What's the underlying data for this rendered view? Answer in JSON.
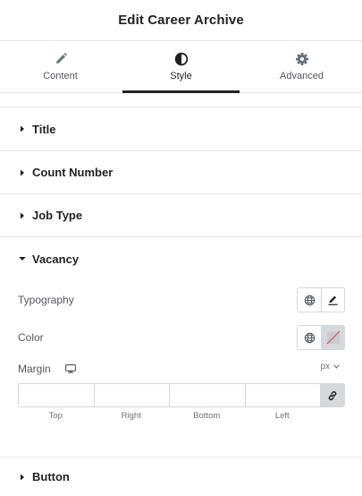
{
  "header": {
    "title": "Edit Career Archive"
  },
  "tabs": [
    {
      "label": "Content",
      "icon": "pencil-icon"
    },
    {
      "label": "Style",
      "icon": "half-circle-icon",
      "active": true
    },
    {
      "label": "Advanced",
      "icon": "gear-icon"
    }
  ],
  "sections": {
    "title": "Title",
    "count": "Count Number",
    "job": "Job Type",
    "vacancy": "Vacancy",
    "button": "Button"
  },
  "vacancy": {
    "typography_label": "Typography",
    "color_label": "Color",
    "margin_label": "Margin",
    "unit": "px",
    "dims": [
      {
        "label": "Top",
        "value": ""
      },
      {
        "label": "Right",
        "value": ""
      },
      {
        "label": "Bottom",
        "value": ""
      },
      {
        "label": "Left",
        "value": ""
      }
    ]
  },
  "colors": {
    "accent": "#1f2124",
    "border": "#d5d8dc",
    "muted": "#515962",
    "clear_slash": "#e04e4e"
  }
}
